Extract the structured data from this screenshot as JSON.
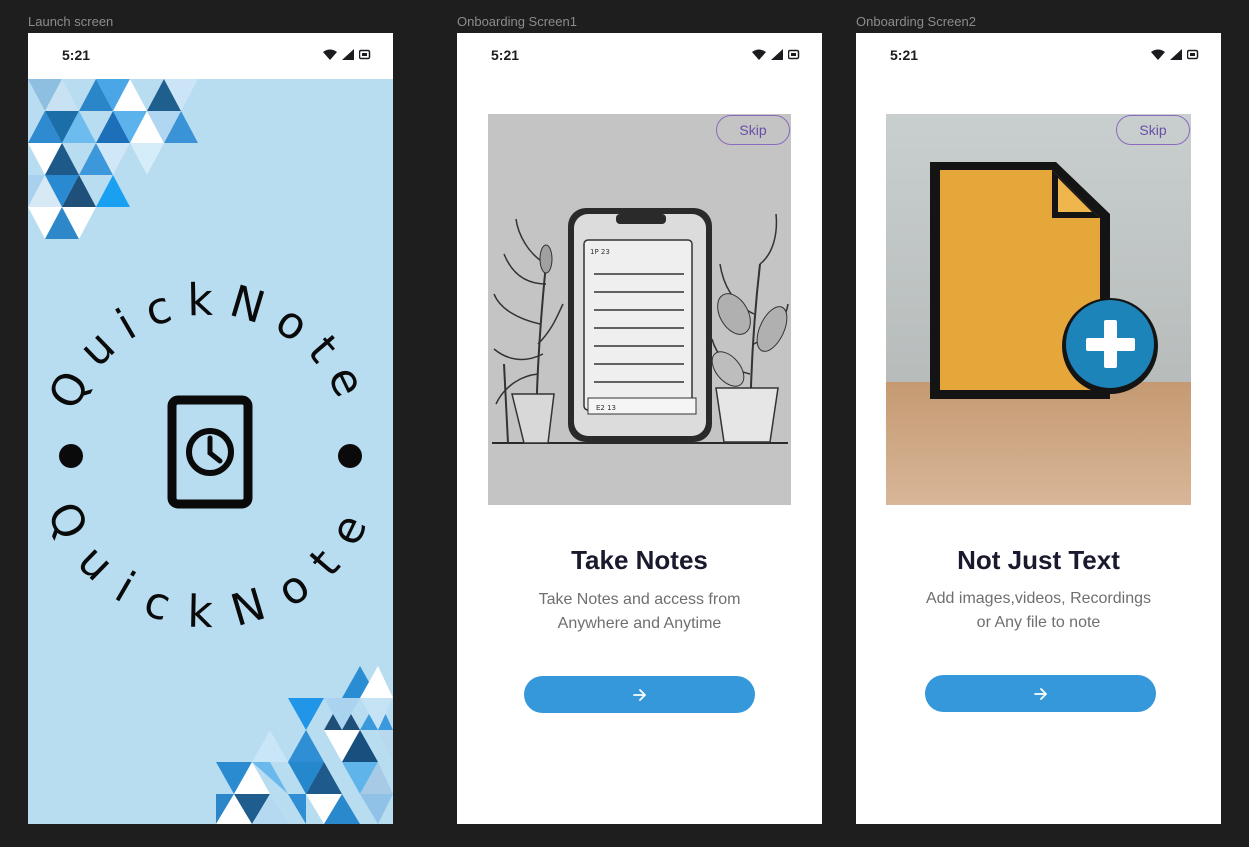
{
  "frames": {
    "launch": {
      "label": "Launch screen"
    },
    "onboarding1": {
      "label": "Onboarding Screen1"
    },
    "onboarding2": {
      "label": "Onboarding Screen2"
    }
  },
  "status_bar": {
    "time": "5:21",
    "icons": [
      "wifi-icon",
      "cell-signal-icon",
      "battery-icon"
    ]
  },
  "launch": {
    "app_name_top": "QuickNote",
    "app_name_bottom": "QuickNote",
    "logo_icon": "clock-tablet-icon",
    "background_color": "#b8dcf0"
  },
  "onboarding1": {
    "skip_label": "Skip",
    "title": "Take Notes",
    "desc_line1": "Take Notes and access from",
    "desc_line2": "Anywhere and Anytime",
    "next_icon": "arrow-right-icon",
    "illustration": "phone-notes-sketch"
  },
  "onboarding2": {
    "skip_label": "Skip",
    "title": "Not Just Text",
    "desc_line1": "Add images,videos, Recordings",
    "desc_line2": "or Any file to note",
    "next_icon": "arrow-right-icon",
    "illustration": "file-add-3d"
  },
  "colors": {
    "accent": "#3498db",
    "skip_border": "#8a6bbd",
    "title": "#1a1a2e",
    "description": "#6f6f6f"
  }
}
